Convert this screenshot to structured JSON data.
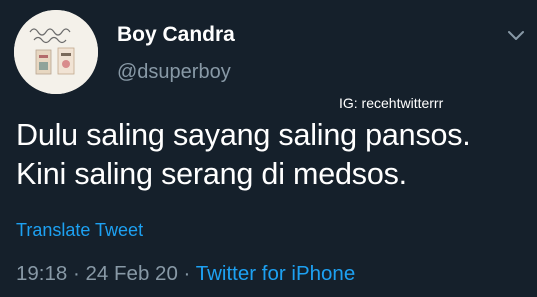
{
  "colors": {
    "background": "#15202b",
    "primary_text": "#ffffff",
    "secondary_text": "#8899a6",
    "link": "#1da1f2"
  },
  "author": {
    "avatar_icon": "book-cover-avatar",
    "name": "Boy Candra",
    "handle": "@dsuperboy"
  },
  "menu_icon": "chevron-down-icon",
  "watermark": "IG: recehtwitterrr",
  "tweet": {
    "lines": [
      "Dulu saling sayang saling pansos.",
      "Kini saling serang di medsos."
    ]
  },
  "translate_label": "Translate Tweet",
  "meta": {
    "time": "19:18",
    "sep1": " · ",
    "date": "24 Feb 20",
    "sep2": " · ",
    "client": "Twitter for iPhone"
  }
}
